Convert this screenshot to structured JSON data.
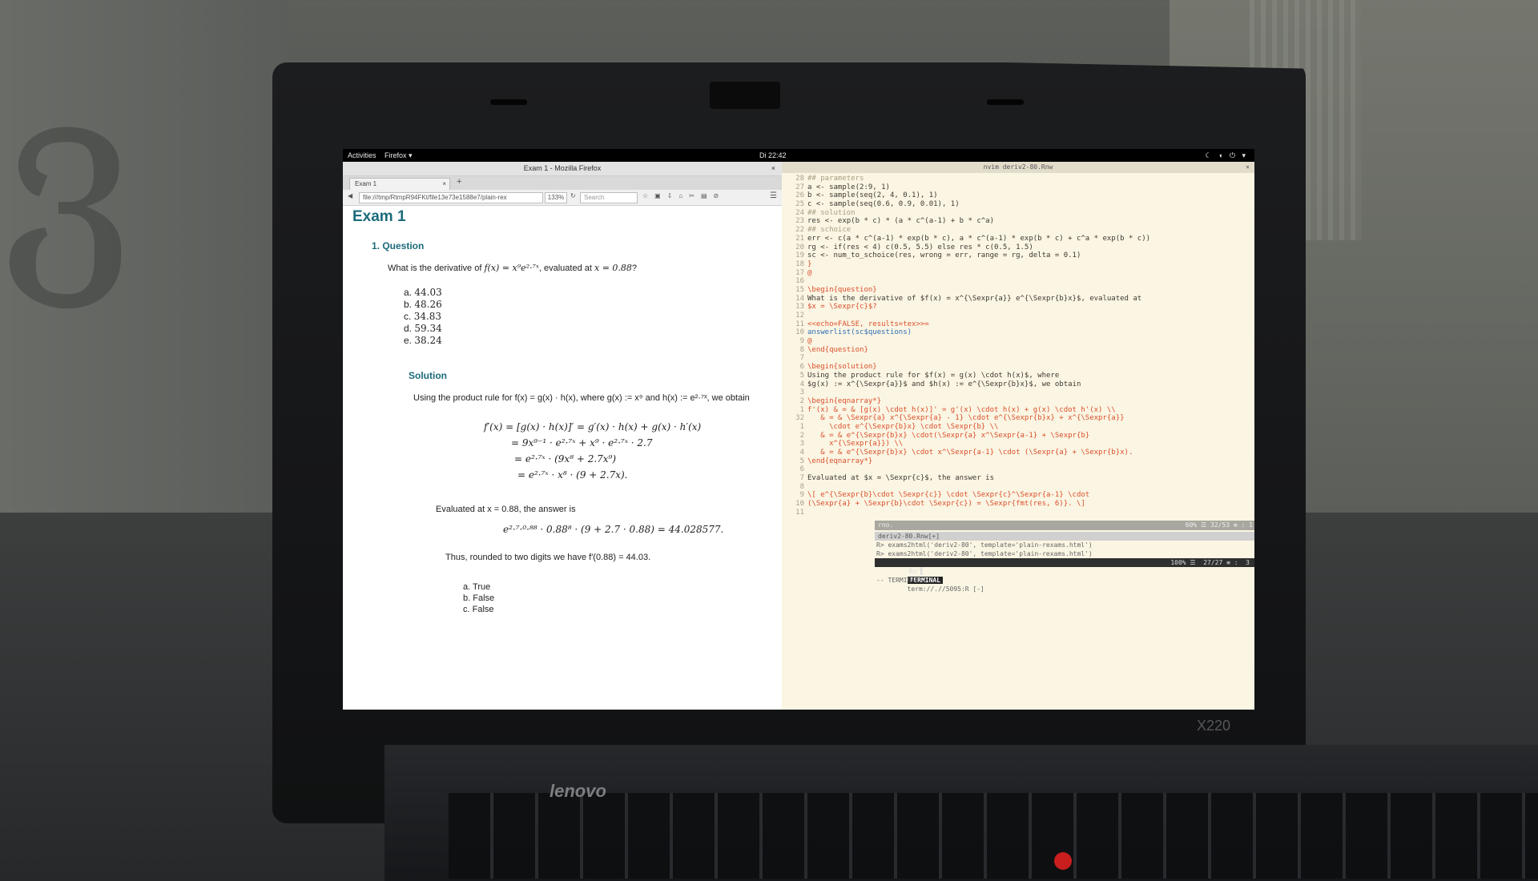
{
  "topbar": {
    "activities": "Activities",
    "app_menu": "Firefox ▾",
    "clock": "Di 22:42",
    "status_icons": "☾ ◖ ⏻ ▾"
  },
  "firefox": {
    "window_title": "Exam 1 - Mozilla Firefox",
    "tab_label": "Exam 1",
    "url": "file:///tmp/RtmpR94FKt/file13e73e1588e7/plain-rex",
    "zoom": "133%",
    "search_placeholder": "Search"
  },
  "exam": {
    "title": "Exam 1",
    "question_heading": "1. Question",
    "question_prefix": "What is the derivative of",
    "question_formula": "f(x) = x⁹e²·⁷ˣ",
    "question_middle": ", evaluated at",
    "question_point": "x = 0.88",
    "question_suffix": "?",
    "answers": [
      {
        "label": "a.",
        "value": "44.03"
      },
      {
        "label": "b.",
        "value": "48.26"
      },
      {
        "label": "c.",
        "value": "34.83"
      },
      {
        "label": "d.",
        "value": "59.34"
      },
      {
        "label": "e.",
        "value": "38.24"
      }
    ],
    "solution_heading": "Solution",
    "solution_intro": "Using the product rule for f(x) = g(x) · h(x), where g(x) := x⁹ and h(x) := e²·⁷ˣ, we obtain",
    "derivation": [
      "f′(x)  =  [g(x) · h(x)]′ = g′(x) · h(x) + g(x) · h′(x)",
      "=  9x⁹⁻¹ · e²·⁷ˣ + x⁹ · e²·⁷ˣ · 2.7",
      "=  e²·⁷ˣ · (9x⁸ + 2.7x⁹)",
      "=  e²·⁷ˣ · x⁸ · (9 + 2.7x)."
    ],
    "evaluated_text": "Evaluated at x = 0.88, the answer is",
    "evaluated_formula": "e²·⁷·⁰·⁸⁸ · 0.88⁸ · (9 + 2.7 · 0.88) = 44.028577.",
    "thus_text": "Thus, rounded to two digits we have f′(0.88) = 44.03.",
    "truth_list": [
      {
        "label": "a.",
        "value": "True"
      },
      {
        "label": "b.",
        "value": "False"
      },
      {
        "label": "c.",
        "value": "False"
      }
    ]
  },
  "vim": {
    "window_title": "nvim deriv2-80.Rnw",
    "lines": [
      {
        "n": "28",
        "t": "## parameters",
        "c": "comment"
      },
      {
        "n": "27",
        "t": "a <- sample(2:9, 1)",
        "c": "mix"
      },
      {
        "n": "26",
        "t": "b <- sample(seq(2, 4, 0.1), 1)",
        "c": "mix"
      },
      {
        "n": "25",
        "t": "c <- sample(seq(0.6, 0.9, 0.01), 1)",
        "c": "mix"
      },
      {
        "n": "24",
        "t": "## solution",
        "c": "comment"
      },
      {
        "n": "23",
        "t": "res <- exp(b * c) * (a * c^(a-1) + b * c^a)",
        "c": "mix"
      },
      {
        "n": "22",
        "t": "## schoice",
        "c": "comment"
      },
      {
        "n": "21",
        "t": "err <- c(a * c^(a-1) * exp(b * c), a * c^(a-1) * exp(b * c) + c^a * exp(b * c))",
        "c": "mix"
      },
      {
        "n": "20",
        "t": "rg <- if(res < 4) c(0.5, 5.5) else res * c(0.5, 1.5)",
        "c": "mix"
      },
      {
        "n": "19",
        "t": "sc <- num_to_schoice(res, wrong = err, range = rg, delta = 0.1)",
        "c": "mix"
      },
      {
        "n": "18",
        "t": "}",
        "c": "red"
      },
      {
        "n": "17",
        "t": "@",
        "c": "red"
      },
      {
        "n": "16",
        "t": "",
        "c": "txt"
      },
      {
        "n": "15",
        "t": "\\begin{question}",
        "c": "red"
      },
      {
        "n": "14",
        "t": "What is the derivative of $f(x) = x^{\\Sexpr{a}} e^{\\Sexpr{b}x}$, evaluated at",
        "c": "txt"
      },
      {
        "n": "13",
        "t": "$x = \\Sexpr{c}$?",
        "c": "red"
      },
      {
        "n": "12",
        "t": "",
        "c": "txt"
      },
      {
        "n": "11",
        "t": "<<echo=FALSE, results=tex>>=",
        "c": "red"
      },
      {
        "n": "10",
        "t": "answerlist(sc$questions)",
        "c": "blue"
      },
      {
        "n": "9",
        "t": "@",
        "c": "red"
      },
      {
        "n": "8",
        "t": "\\end{question}",
        "c": "red"
      },
      {
        "n": "7",
        "t": "",
        "c": "txt"
      },
      {
        "n": "6",
        "t": "\\begin{solution}",
        "c": "red"
      },
      {
        "n": "5",
        "t": "Using the product rule for $f(x) = g(x) \\cdot h(x)$, where",
        "c": "txt"
      },
      {
        "n": "4",
        "t": "$g(x) := x^{\\Sexpr{a}}$ and $h(x) := e^{\\Sexpr{b}x}$, we obtain",
        "c": "txt"
      },
      {
        "n": "3",
        "t": "",
        "c": "txt"
      },
      {
        "n": "2",
        "t": "\\begin{eqnarray*}",
        "c": "red"
      },
      {
        "n": "1",
        "t": "f'(x) & = & [g(x) \\cdot h(x)]' = g'(x) \\cdot h(x) + g(x) \\cdot h'(x) \\\\",
        "c": "red"
      },
      {
        "n": "32",
        "t": "   & = & \\Sexpr{a} x^{\\Sexpr{a} - 1} \\cdot e^{\\Sexpr{b}x} + x^{\\Sexpr{a}}",
        "c": "red"
      },
      {
        "n": "1",
        "t": "     \\cdot e^{\\Sexpr{b}x} \\cdot \\Sexpr{b} \\\\",
        "c": "red"
      },
      {
        "n": "2",
        "t": "   & = & e^{\\Sexpr{b}x} \\cdot(\\Sexpr{a} x^\\Sexpr{a-1} + \\Sexpr{b}",
        "c": "red"
      },
      {
        "n": "3",
        "t": "     x^{\\Sexpr{a}}) \\\\",
        "c": "red"
      },
      {
        "n": "4",
        "t": "   & = & e^{\\Sexpr{b}x} \\cdot x^\\Sexpr{a-1} \\cdot (\\Sexpr{a} + \\Sexpr{b}x).",
        "c": "red"
      },
      {
        "n": "5",
        "t": "\\end{eqnarray*}",
        "c": "red"
      },
      {
        "n": "6",
        "t": "",
        "c": "txt"
      },
      {
        "n": "7",
        "t": "Evaluated at $x = \\Sexpr{c}$, the answer is",
        "c": "txt"
      },
      {
        "n": "8",
        "t": "",
        "c": "txt"
      },
      {
        "n": "9",
        "t": "\\[ e^{\\Sexpr{b}\\cdot \\Sexpr{c}} \\cdot \\Sexpr{c}^\\Sexpr{a-1} \\cdot",
        "c": "red"
      },
      {
        "n": "10",
        "t": "(\\Sexpr{a} + \\Sexpr{b}\\cdot \\Sexpr{c}) = \\Sexpr{fmt(res, 6)}. \\]",
        "c": "red"
      },
      {
        "n": "11",
        "t": "",
        "c": "txt"
      }
    ],
    "status_left": "rno.",
    "status_right": "60% ☰  32/53 ≡ :  1",
    "file_status": "deriv2-80.Rnw[+]",
    "terminal_lines": [
      "R> exams2html('deriv2-80', template='plain-rexams.html')",
      "R> exams2html('deriv2-80', template='plain-rexams.html')",
      "R> ▌"
    ],
    "term_status_right": "100% ☰  27/27 ≡ :  3",
    "terminal_label": "TERMINAL",
    "terminal_path": "term://.//5095:R [-]",
    "terminal_label2": "-- TERMINAL --"
  },
  "hardware": {
    "brand": "lenovo",
    "model": "X220"
  }
}
